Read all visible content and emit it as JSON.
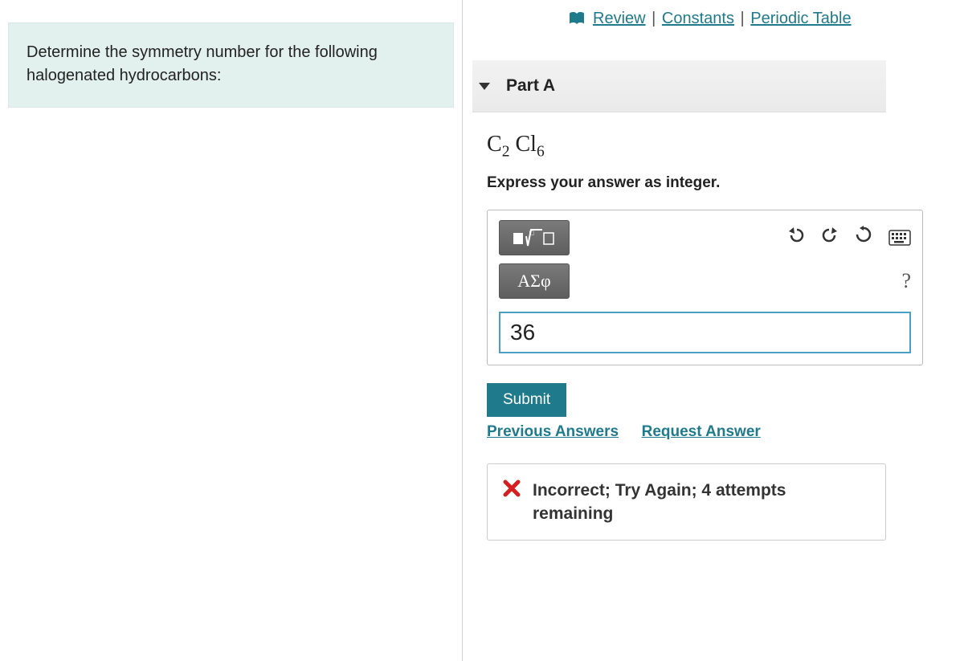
{
  "prompt": "Determine the symmetry number for the following halogenated hydrocarbons:",
  "topLinks": {
    "review": "Review",
    "constants": "Constants",
    "periodic": "Periodic Table"
  },
  "part": {
    "label": "Part A",
    "formula_html": "C<sub>2</sub> Cl<sub>6</sub>",
    "instruction": "Express your answer as integer."
  },
  "toolbar": {
    "greek_label": "ΑΣφ"
  },
  "answer": {
    "value": "36"
  },
  "actions": {
    "submit": "Submit",
    "previous": "Previous Answers",
    "request": "Request Answer"
  },
  "feedback": {
    "text": "Incorrect; Try Again; 4 attempts remaining"
  },
  "icons": {
    "book": "book-icon",
    "template": "template-icon",
    "undo": "undo-icon",
    "redo": "redo-icon",
    "reset": "reset-icon",
    "keyboard": "keyboard-icon",
    "help": "help-icon",
    "wrong": "wrong-icon"
  }
}
